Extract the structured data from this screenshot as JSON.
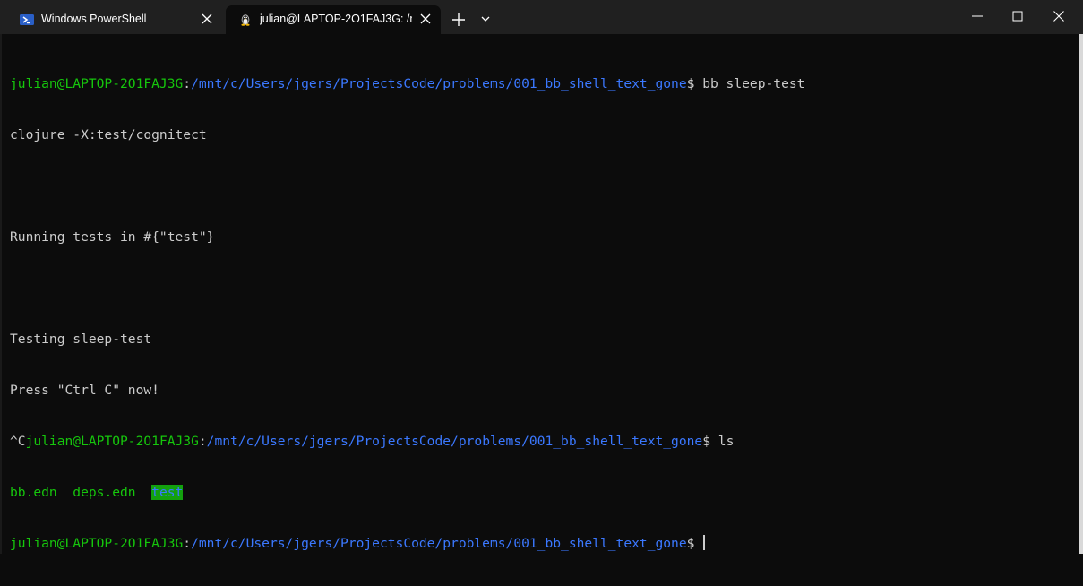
{
  "tabs": [
    {
      "label": "Windows PowerShell",
      "icon": "powershell-icon",
      "active": false
    },
    {
      "label": "julian@LAPTOP-2O1FAJ3G: /m",
      "icon": "linux-penguin-icon",
      "active": true
    }
  ],
  "titlebar": {
    "new_tab_icon": "plus-icon",
    "dropdown_icon": "chevron-down-icon",
    "controls": [
      "minimize-icon",
      "maximize-icon",
      "close-icon"
    ]
  },
  "colors": {
    "background": "#0c0c0c",
    "titlebar": "#202020",
    "prompt_user": "#16c60c",
    "prompt_path": "#3b78ff",
    "text": "#cccccc",
    "dir_highlight": "#13a10e"
  },
  "terminal": {
    "line1": {
      "user": "julian@LAPTOP-2O1FAJ3G",
      "sep": ":",
      "path": "/mnt/c/Users/jgers/ProjectsCode/problems/001_bb_shell_text_gone",
      "prompt": "$ ",
      "cmd": "bb sleep-test"
    },
    "line2": "clojure -X:test/cognitect",
    "line3": "",
    "line4": "Running tests in #{\"test\"}",
    "line5": "",
    "line6": "Testing sleep-test",
    "line7": "Press \"Ctrl C\" now!",
    "line8": {
      "prefix": "^C",
      "user": "julian@LAPTOP-2O1FAJ3G",
      "sep": ":",
      "path": "/mnt/c/Users/jgers/ProjectsCode/problems/001_bb_shell_text_gone",
      "prompt": "$ ",
      "cmd": "ls"
    },
    "line9": {
      "file1": "bb.edn",
      "gap1": "  ",
      "file2": "deps.edn",
      "gap2": "  ",
      "dir1": "test"
    },
    "line10": {
      "user": "julian@LAPTOP-2O1FAJ3G",
      "sep": ":",
      "path": "/mnt/c/Users/jgers/ProjectsCode/problems/001_bb_shell_text_gone",
      "prompt": "$ "
    }
  }
}
